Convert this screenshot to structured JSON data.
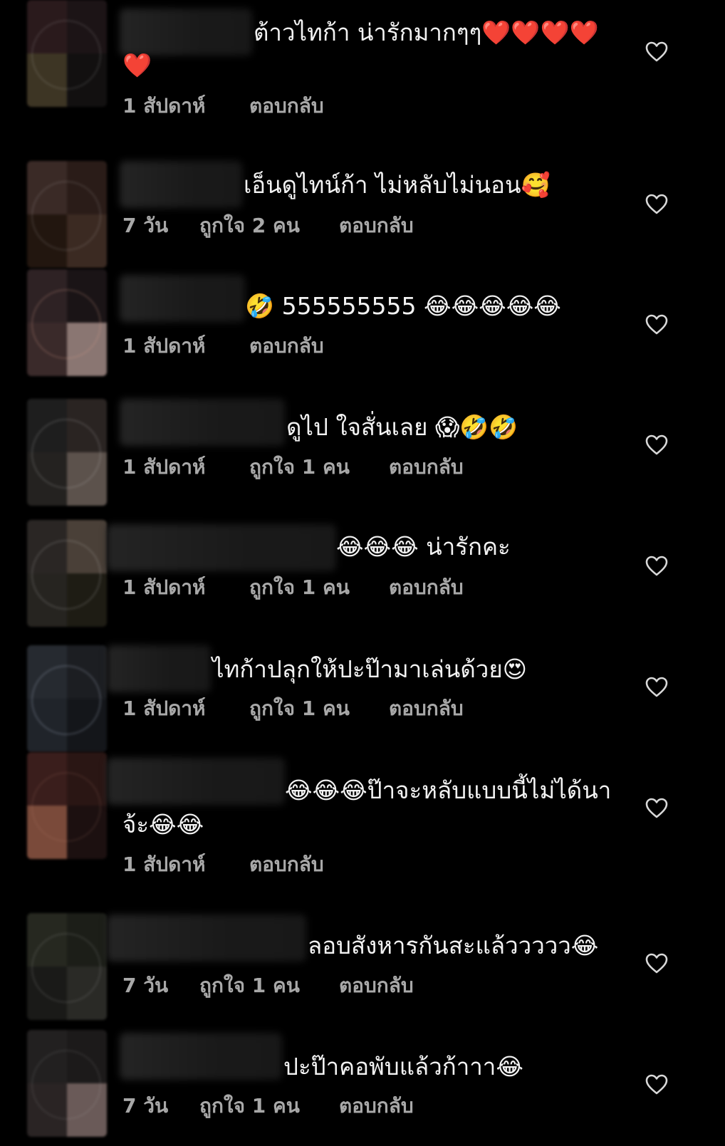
{
  "comments": [
    {
      "text": "ต้าวไทก้า น่ารักมากๆๆ❤️❤️❤️❤️",
      "text2": "❤️",
      "time": "1 สัปดาห์",
      "likes": "",
      "reply": "ตอบกลับ"
    },
    {
      "text": "เอ็นดูไทน์ก้า ไม่หลับไม่นอน🥰",
      "text2": "",
      "time": "7 วัน",
      "likes": "ถูกใจ 2 คน",
      "reply": "ตอบกลับ"
    },
    {
      "text": "🤣 555555555 😂😂😂😂😂",
      "text2": "",
      "time": "1 สัปดาห์",
      "likes": "",
      "reply": "ตอบกลับ"
    },
    {
      "text": "ดูไป ใจสั่นเลย 😱🤣🤣",
      "text2": "",
      "time": "1 สัปดาห์",
      "likes": "ถูกใจ 1 คน",
      "reply": "ตอบกลับ"
    },
    {
      "text": "😂😂😂 น่ารักคะ",
      "text2": "",
      "time": "1 สัปดาห์",
      "likes": "ถูกใจ 1 คน",
      "reply": "ตอบกลับ"
    },
    {
      "text": "ไทก้าปลุกให้ปะป๊ามาเล่นด้วย😍",
      "text2": "",
      "time": "1 สัปดาห์",
      "likes": "ถูกใจ 1 คน",
      "reply": "ตอบกลับ"
    },
    {
      "text": "😂😂😂ป๊าจะหลับแบบนี้ไม่ได้นา",
      "text2": "จ้ะ😂😂",
      "time": "1 สัปดาห์",
      "likes": "",
      "reply": "ตอบกลับ"
    },
    {
      "text": "ลอบสังหารกันสะแล้ววววว😂",
      "text2": "",
      "time": "7 วัน",
      "likes": "ถูกใจ 1 คน",
      "reply": "ตอบกลับ"
    },
    {
      "text": "ปะป๊าคอพับแล้วก้าาา😂",
      "text2": "",
      "time": "7 วัน",
      "likes": "ถูกใจ 1 คน",
      "reply": "ตอบกลับ"
    }
  ],
  "colors": {
    "background": "#000000",
    "text": "#f2f2f2",
    "meta": "#a8a8a8",
    "icon": "#d8d8d8"
  },
  "icons": {
    "like": "heart-outline-icon"
  }
}
